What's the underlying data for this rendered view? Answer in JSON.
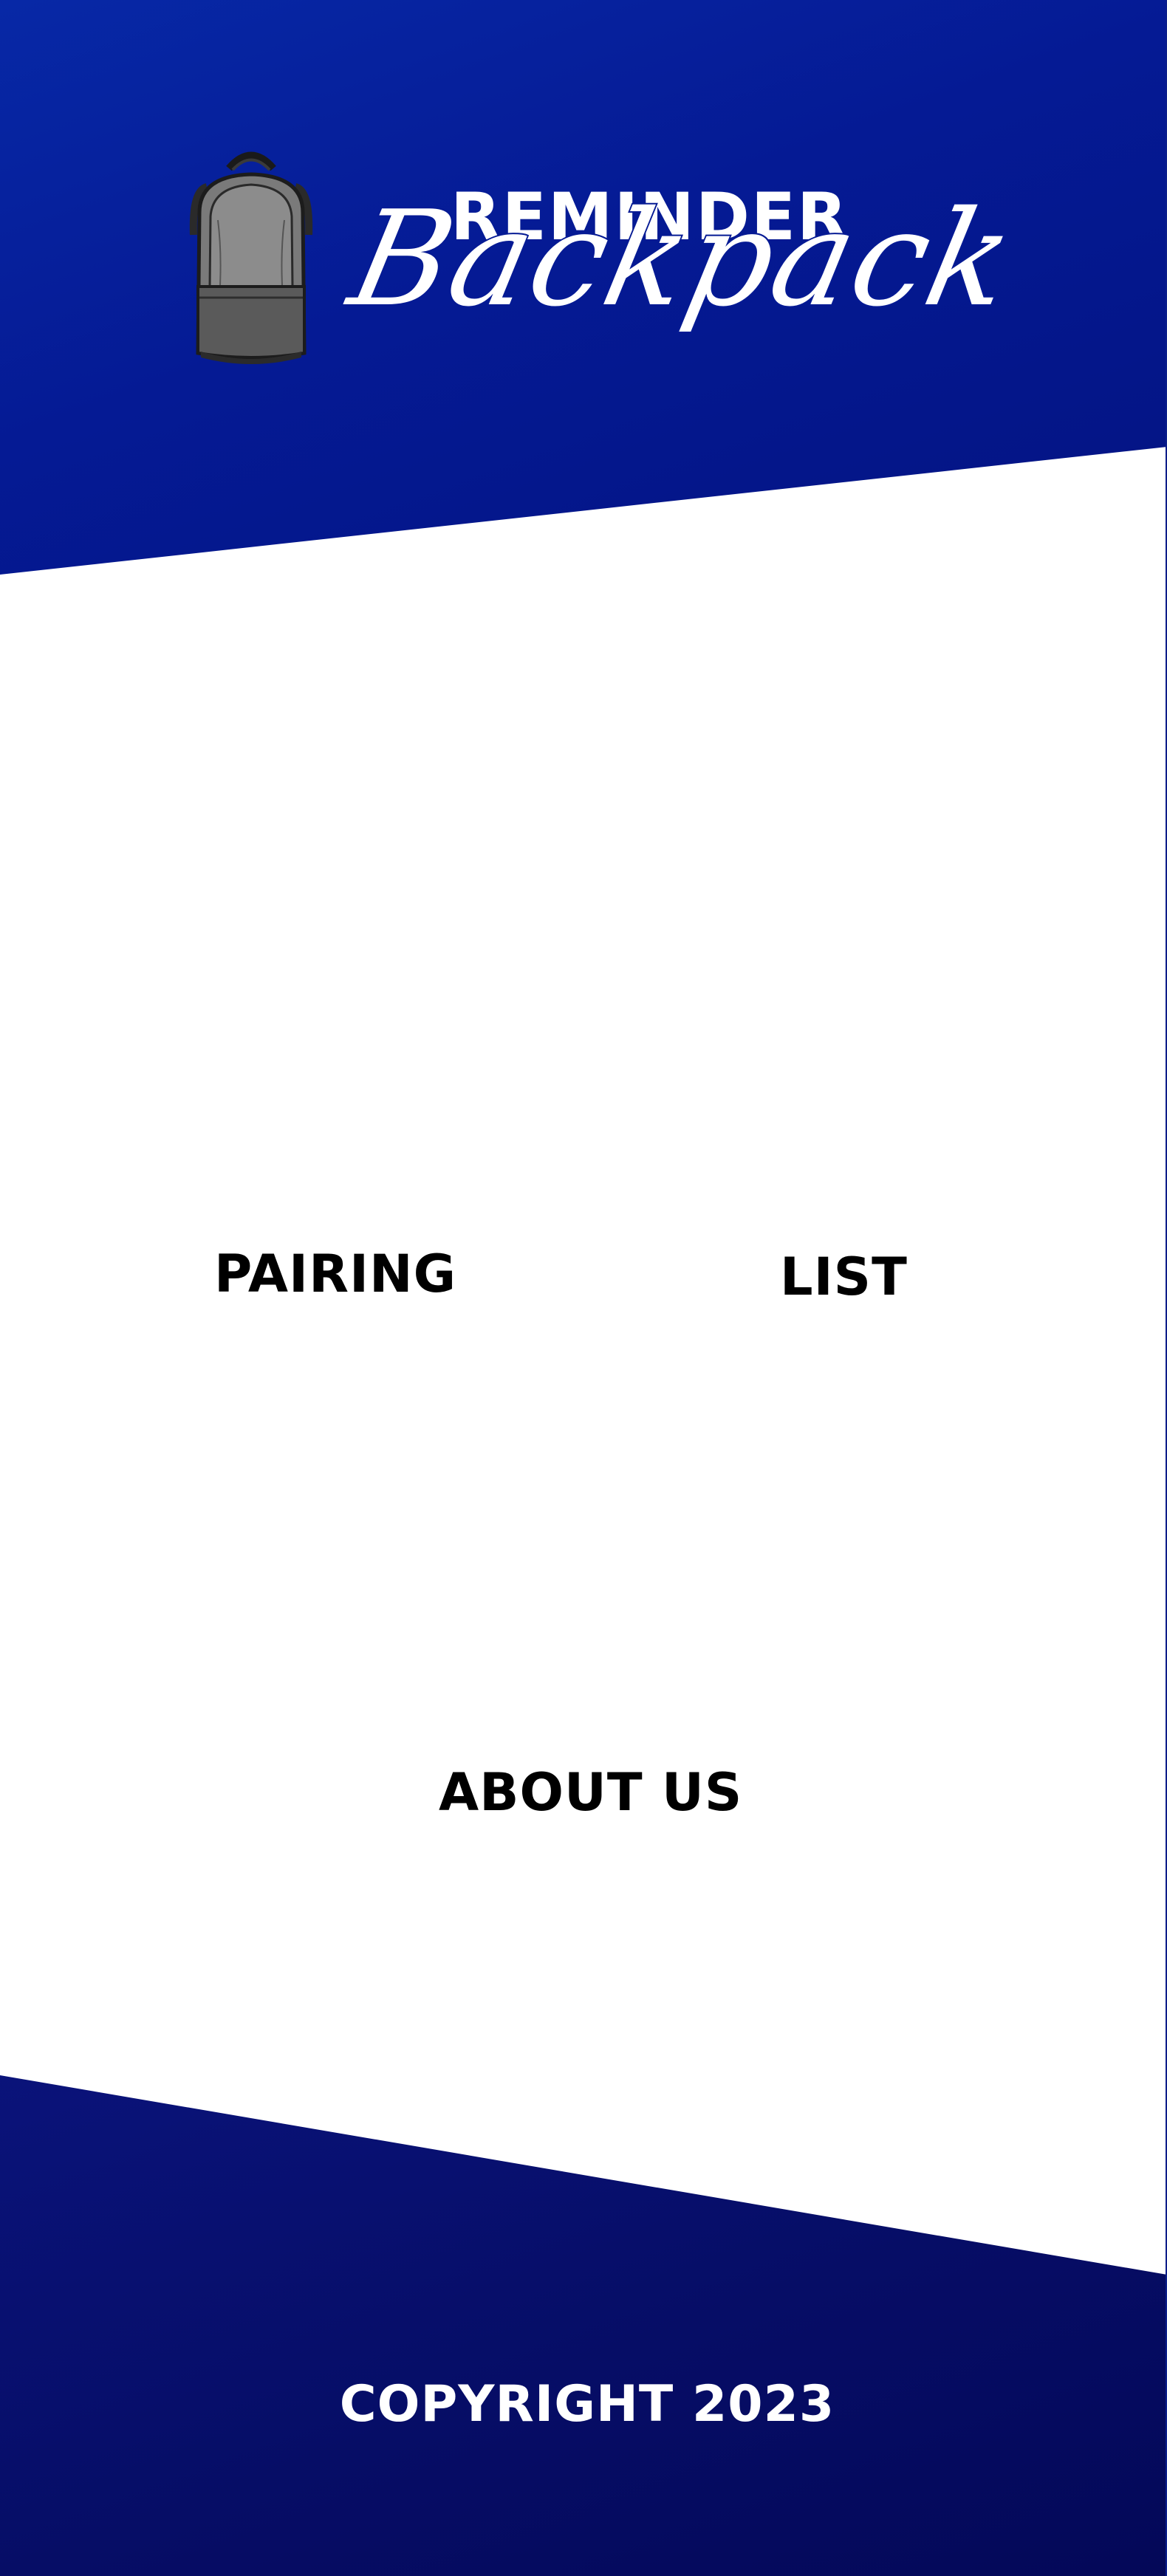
{
  "brand": {
    "title_top": "REMINDER",
    "title_script": "Backpack",
    "logo_icon": "backpack-icon"
  },
  "nav": {
    "pairing_label": "PAIRING",
    "list_label": "LIST",
    "about_label": "ABOUT US"
  },
  "footer": {
    "copyright": "COPYRIGHT 2023"
  },
  "colors": {
    "header_blue": "#051a94",
    "footer_navy": "#060d66",
    "text_black": "#000000",
    "text_white": "#ffffff"
  }
}
